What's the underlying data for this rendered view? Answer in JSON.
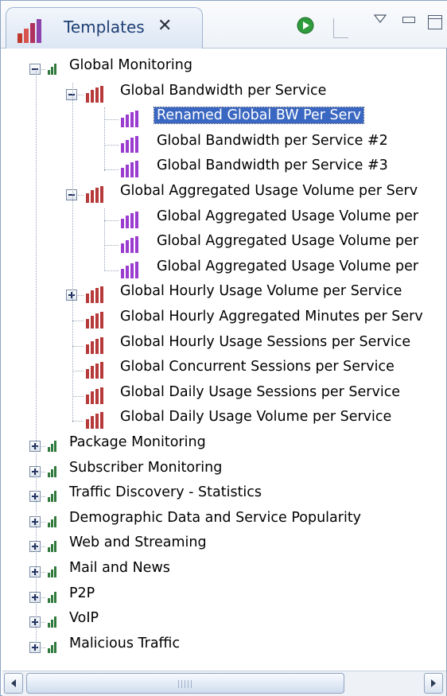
{
  "view": {
    "title": "Templates",
    "close_glyph": "✕",
    "icons": [
      "chart-icon",
      "run-icon",
      "view-menu-icon",
      "minimize-icon",
      "maximize-icon"
    ]
  },
  "tree": {
    "groups": [
      {
        "label": "Global Monitoring",
        "expanded": true,
        "children": [
          {
            "label": "Global Bandwidth per Service",
            "expanded": true,
            "children": [
              {
                "label": "Renamed Global BW Per Serv",
                "selected": true
              },
              {
                "label": "Global Bandwidth per Service #2"
              },
              {
                "label": "Global Bandwidth per Service #3"
              }
            ]
          },
          {
            "label": "Global Aggregated Usage Volume per Serv",
            "expanded": true,
            "children": [
              {
                "label": "Global Aggregated Usage Volume per"
              },
              {
                "label": "Global Aggregated Usage Volume per"
              },
              {
                "label": "Global Aggregated Usage Volume per"
              }
            ]
          },
          {
            "label": "Global Hourly Usage Volume per Service",
            "expanded": false
          },
          {
            "label": "Global Hourly Aggregated Minutes per Serv"
          },
          {
            "label": "Global Hourly Usage Sessions per Service"
          },
          {
            "label": "Global Concurrent Sessions per Service"
          },
          {
            "label": "Global Daily Usage Sessions per Service"
          },
          {
            "label": "Global Daily Usage Volume per Service"
          }
        ]
      },
      {
        "label": "Package Monitoring",
        "expanded": false
      },
      {
        "label": "Subscriber Monitoring",
        "expanded": false
      },
      {
        "label": "Traffic Discovery - Statistics",
        "expanded": false
      },
      {
        "label": "Demographic Data and Service Popularity",
        "expanded": false
      },
      {
        "label": "Web and Streaming",
        "expanded": false
      },
      {
        "label": "Mail and News",
        "expanded": false
      },
      {
        "label": "P2P",
        "expanded": false
      },
      {
        "label": "VoIP",
        "expanded": false
      },
      {
        "label": "Malicious Traffic",
        "expanded": false
      }
    ]
  },
  "colors": {
    "selection": "#3a67c1",
    "group_icon": "#2f7a3c",
    "template_icon": "#b73a3a",
    "instance_icon": "#9a3ccf"
  }
}
